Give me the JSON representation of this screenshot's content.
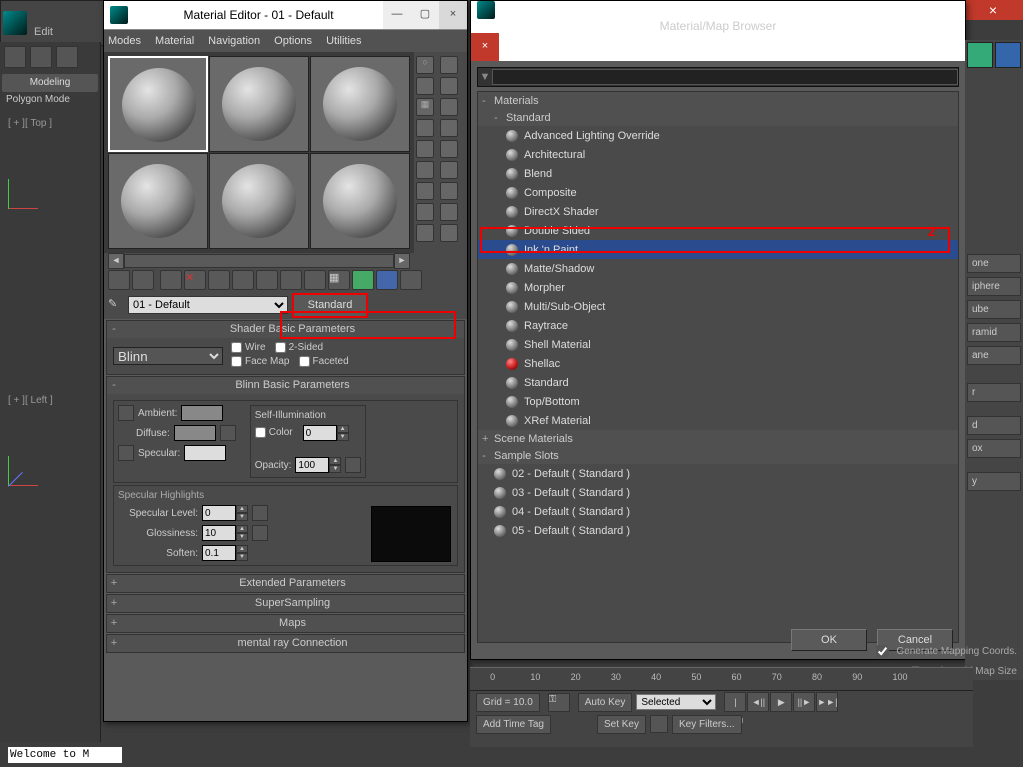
{
  "app": {
    "edit_label": "Edit",
    "close": "×",
    "modeling": "Modeling",
    "poly_model": "Polygon Mode"
  },
  "viewports": {
    "top": "[ + ][ Top ]",
    "left": "[ + ][ Left ]"
  },
  "mat_editor": {
    "title": "Material Editor - 01 - Default",
    "menus": [
      "Modes",
      "Material",
      "Navigation",
      "Options",
      "Utilities"
    ],
    "min": "—",
    "max": "▢",
    "close": "×",
    "scroll_left": "◄",
    "scroll_right": "►",
    "pick_name": "01 - Default",
    "type_btn": "Standard",
    "shader_rollout": "Shader Basic Parameters",
    "shader": "Blinn",
    "wire": "Wire",
    "two_sided": "2-Sided",
    "face_map": "Face Map",
    "faceted": "Faceted",
    "blinn_rollout": "Blinn Basic Parameters",
    "self_illum": "Self-Illumination",
    "color": "Color",
    "color_val": "0",
    "ambient": "Ambient:",
    "diffuse": "Diffuse:",
    "specular": "Specular:",
    "opacity": "Opacity:",
    "opacity_val": "100",
    "spec_hi": "Specular Highlights",
    "spec_level": "Specular Level:",
    "spec_level_val": "0",
    "gloss": "Glossiness:",
    "gloss_val": "10",
    "soften": "Soften:",
    "soften_val": "0.1",
    "rollouts": [
      "Extended Parameters",
      "SuperSampling",
      "Maps",
      "mental ray Connection"
    ]
  },
  "browser": {
    "title": "Material/Map Browser",
    "close": "×",
    "materials": "Materials",
    "standard": "Standard",
    "items": [
      "Advanced Lighting Override",
      "Architectural",
      "Blend",
      "Composite",
      "DirectX Shader",
      "Double Sided",
      "Ink 'n Paint",
      "Matte/Shadow",
      "Morpher",
      "Multi/Sub-Object",
      "Raytrace",
      "Shell Material",
      "Shellac",
      "Standard",
      "Top/Bottom",
      "XRef Material"
    ],
    "selected_index": 6,
    "red_index": 12,
    "scene_mat": "Scene Materials",
    "sample_slots": "Sample Slots",
    "slots": [
      "02 - Default  ( Standard )",
      "03 - Default  ( Standard )",
      "04 - Default  ( Standard )",
      "05 - Default  ( Standard )"
    ],
    "ok": "OK",
    "cancel": "Cancel"
  },
  "right": {
    "opts": [
      "one",
      "iphere",
      "ube",
      "ramid",
      "ane",
      "r",
      "d",
      "ox",
      "y"
    ]
  },
  "timeline": {
    "ticks": [
      "0",
      "10",
      "20",
      "30",
      "40",
      "50",
      "60",
      "70",
      "80",
      "90",
      "100"
    ],
    "grid": "Grid = 10.0",
    "add_time": "Add Time Tag",
    "auto_key": "Auto Key",
    "selected": "Selected",
    "set_key": "Set Key",
    "key_filters": "Key Filters...",
    "play": [
      "|◄◄",
      "◄||",
      "▶",
      "||►",
      "►►|"
    ],
    "gen_map": "Generate Mapping Coords.",
    "real_world": "Real-World Map Size"
  },
  "welcome": "Welcome to M"
}
